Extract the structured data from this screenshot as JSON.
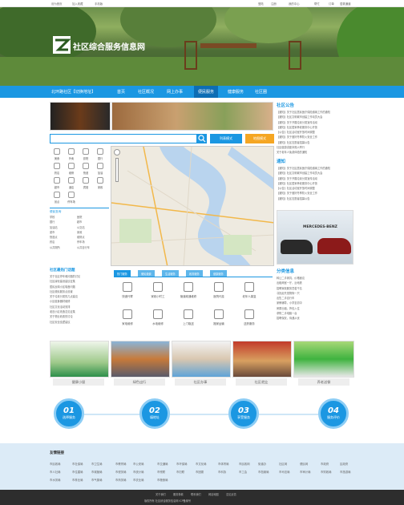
{
  "topbar": {
    "left_items": [
      "设为首页",
      "加入收藏",
      "手机版"
    ],
    "right_items": [
      "登陆",
      "注册",
      "我的中心",
      "帮忙",
      "订单",
      "居委通道"
    ]
  },
  "banner": {
    "site_name": "社区综合服务信息网"
  },
  "nav": {
    "location": "北环路社区【切换地址】",
    "items": [
      "首页",
      "社区概况",
      "网上办事",
      "便民服务",
      "健康服务",
      "社区圈"
    ],
    "active_index": 3
  },
  "search": {
    "placeholder": "",
    "btn1": "列表模式",
    "btn2": "地图模式"
  },
  "quick_icons": [
    "美食",
    "外卖",
    "影院",
    "银行",
    "药店",
    "维修",
    "快递",
    "加油",
    "超市",
    "酒店",
    "宾馆",
    "家政",
    "景点",
    "停车场"
  ],
  "cat_list": {
    "title": "便民查询",
    "rows": [
      [
        "学校",
        "医院"
      ],
      [
        "银行",
        "超市"
      ],
      [
        "加油站",
        "公交站"
      ],
      [
        "菜市",
        "家政"
      ],
      [
        "快递点",
        "维修点"
      ],
      [
        "药店",
        "停车场"
      ],
      [
        "公共厕所",
        "公共自行车"
      ]
    ]
  },
  "notice": {
    "title": "社区公告",
    "items": [
      "【通知】关于社区居民医疗保险缴纳工作的通知",
      "【通知】社区文明城市创建工作动员大会",
      "【通知】关于开展垃圾分类宣传活动",
      "【通知】社区居家养老服务中心开放",
      "【公告】社区活动室开放时间调整",
      "【通知】关于做好冬季防火安全工作",
      "【通知】社区志愿者招募公告",
      "社区健康讲座本周六举行",
      "关于老年人免费体检的通知"
    ]
  },
  "tongzhi": {
    "title": "通知",
    "items": [
      "【通知】关于社区居民医疗保险缴纳工作的通知",
      "【通知】社区文明城市创建工作动员大会",
      "【通知】关于开展垃圾分类宣传活动",
      "【通知】社区居家养老服务中心开放",
      "【公告】社区活动室开放时间调整",
      "【通知】关于做好冬季防火安全工作",
      "【通知】社区志愿者招募公告"
    ]
  },
  "ad": {
    "brand": "MERCEDES-BENZ"
  },
  "hot": {
    "title": "社区最热门话题",
    "items": [
      "关于社区停车难问题的讨论",
      "社区绿化建设建议征集",
      "居民反映小区噪音问题",
      "社区便民服务点设置",
      "关于垃圾分类的几点建议",
      "小区健身器材维修",
      "社区文化活动安排",
      "老旧小区改造意见征集",
      "关于物业收费的讨论",
      "社区安全巡逻建议"
    ]
  },
  "svc_tabs": [
    "热门服务",
    "便民缴费",
    "生活服务",
    "政务服务",
    "健康服务"
  ],
  "services": [
    "快递代寄",
    "家政小时工",
    "管道疏通维修",
    "医院代挂",
    "老年人康复",
    "家电维修",
    "水电维修",
    "上门取送",
    "搬家运输",
    "送药服务"
  ],
  "classified": {
    "title": "分类信息",
    "items": [
      "转让二手家具，价格面议",
      "出租两室一厅，近地铁",
      "招聘家政服务员若干名",
      "寻找走失宠物狗一只",
      "出售二手自行车",
      "家教辅导，小学至初中",
      "房屋出租，拎包入住",
      "求购二手电脑一台",
      "招聘保安，待遇从优"
    ]
  },
  "photos": [
    "健康小屋",
    "绿色出行",
    "社区办事",
    "社区就业",
    "养老送餐"
  ],
  "steps": [
    {
      "num": "01",
      "label": "选择服务"
    },
    {
      "num": "02",
      "label": "填地址"
    },
    {
      "num": "03",
      "label": "享受服务"
    },
    {
      "num": "04",
      "label": "服务评价"
    }
  ],
  "friend_links": {
    "title": "友情链接",
    "items": [
      "市民政局",
      "市社保局",
      "市卫生局",
      "市教育局",
      "市公安局",
      "市交通局",
      "市环保局",
      "市文化局",
      "市体育局",
      "市民政网",
      "街道办",
      "社区网",
      "便民网",
      "市政府",
      "区政府",
      "市人社局",
      "市住建局",
      "市城管局",
      "市税务局",
      "市统计局",
      "市残联",
      "市妇联",
      "市团委",
      "市科协",
      "市工会",
      "市档案局",
      "市司法局",
      "市审计局",
      "市财政局",
      "市旅游局",
      "市水务局",
      "市林业局",
      "市气象局",
      "市商务局",
      "市农业局",
      "市粮食局"
    ]
  },
  "footer": {
    "links": [
      "关于我们",
      "服务条款",
      "联系我们",
      "网站地图",
      "意见反馈"
    ],
    "line2": "版权所有 社区综合服务信息网 ICP备案号"
  },
  "colors": {
    "primary": "#1b97e2",
    "dark": "#0d6db4",
    "light_bg": "#dcebf7"
  }
}
